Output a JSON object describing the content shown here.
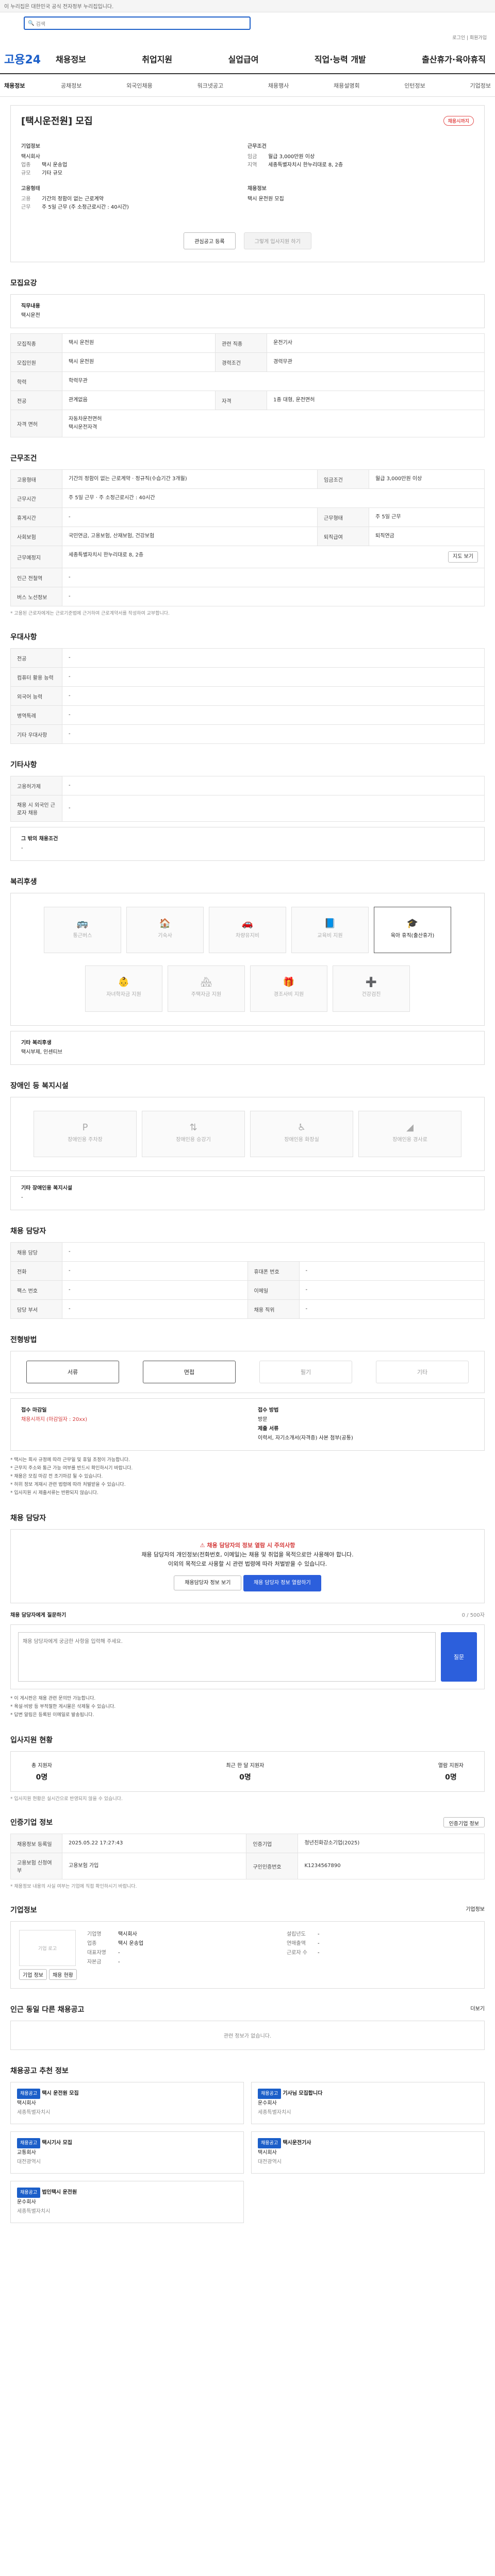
{
  "top": {
    "notice": "이 누리집은 대한민국 공식 전자정부 누리집입니다."
  },
  "header": {
    "search_placeholder": "검색",
    "login": "로그인",
    "join": "회원가입",
    "logo": "고용24",
    "menu": [
      "채용정보",
      "취업지원",
      "실업급여",
      "직업·능력 개발",
      "출산휴가·육아휴직"
    ]
  },
  "lnb": {
    "first": "채용정보",
    "items": [
      "공채정보",
      "외국인채용",
      "워크넷공고",
      "채용행사",
      "채용설명회",
      "인턴정보",
      "기업정보"
    ]
  },
  "job": {
    "title": "[택시운전원] 모집",
    "badge": "채용시까지",
    "company_label": "기업정보",
    "company": "택시회사",
    "company_rows": [
      {
        "k": "업종",
        "v": "택시 운송업"
      },
      {
        "k": "규모",
        "v": "기타 규모"
      }
    ],
    "cond_label": "근무조건",
    "cond_rows": [
      {
        "k": "임금",
        "v": "월급 3,000만원 이상"
      },
      {
        "k": "지역",
        "v": "세종특별자치시 한누리대로 8, 2층"
      }
    ],
    "type_label": "고용형태",
    "type_rows": [
      {
        "k": "고용",
        "v": "기간의 정함이 없는 근로계약"
      },
      {
        "k": "근무",
        "v": "주 5일 근무 (주 소정근로시간 : 40시간)"
      }
    ],
    "process_label": "채용정보",
    "process_v": "택시 운전원 모집",
    "btn_save": "관심공고 등록",
    "btn_apply": "그렇게 입사지원 하기"
  },
  "sec": {
    "req": "모집요강",
    "cond": "근무조건",
    "welfare": "우대사항",
    "other": "기타사항",
    "benefit": "복리후생",
    "disability": "장애인 등 복지시설",
    "process": "전형방법",
    "contact": "채용 담당자",
    "interview": "입사지원 현황",
    "info": "인증기업 정보",
    "corp": "기업정보",
    "related": "인근 동일 다른 채용공고",
    "rec": "채용공고 추천 정보"
  },
  "req": {
    "duty_label": "직무내용",
    "duty": "택시운전",
    "rows": [
      {
        "k": "모집직종",
        "v": "택시 운전원",
        "k2": "관련 직종",
        "v2": "운전기사"
      },
      {
        "k": "모집인원",
        "v": "택시 운전원",
        "k2": "경력조건",
        "v2": "경력무관"
      },
      {
        "k": "학력",
        "v": "학력무관",
        "k2": "",
        "v2": ""
      },
      {
        "k": "전공",
        "v": "관계없음",
        "k2": "자격",
        "v2": "1종 대형, 운전면허"
      }
    ],
    "lic_label": "자격 면허",
    "lic": [
      "자동차운전면허",
      "택시운전자격"
    ]
  },
  "cond": {
    "rows": [
      {
        "k": "고용형태",
        "v": "기간의 정함이 없는 근로계약 · 정규직(수습기간 3개월)",
        "k2": "임금조건",
        "v2": "월급 3,000만원 이상"
      },
      {
        "k": "근무시간",
        "v": "주 5일 근무 · 주 소정근로시간 : 40시간",
        "k2": "",
        "v2": ""
      },
      {
        "k": "휴게시간",
        "v": "-",
        "k2": "근무형태",
        "v2": "주 5일 근무"
      },
      {
        "k": "사회보험",
        "v": "국민연금, 고용보험, 산재보험, 건강보험",
        "k2": "퇴직급여",
        "v2": "퇴직연금"
      },
      {
        "k": "근무예정지",
        "v": "세종특별자치시 한누리대로 8, 2층",
        "k2": "",
        "v2": ""
      },
      {
        "k": "인근 전철역",
        "v": "-",
        "k2": "",
        "v2": ""
      },
      {
        "k": "버스 노선정보",
        "v": "-",
        "k2": "",
        "v2": ""
      }
    ],
    "map_btn": "지도 보기",
    "note": "* 고용된 근로자에게는 근로기준법에 근거하여 근로계약서를 작성하여 교부합니다."
  },
  "welfare": {
    "rows": [
      {
        "k": "전공",
        "v": "-"
      },
      {
        "k": "컴퓨터 활용 능력",
        "v": "-"
      },
      {
        "k": "외국어 능력",
        "v": "-"
      },
      {
        "k": "병역특례",
        "v": "-"
      },
      {
        "k": "기타 우대사항",
        "v": "-"
      }
    ]
  },
  "other": {
    "rows": [
      {
        "k": "고용허가제",
        "v": "-"
      },
      {
        "k": "채용 시 외국인 근로자 채용",
        "v": "-"
      }
    ],
    "note_label": "그 밖의 채용조건",
    "note": "-"
  },
  "benefit": {
    "items": [
      "통근버스",
      "기숙사",
      "차량유지비",
      "교육비 지원",
      "육아 휴직(출산휴가)",
      "자녀학자금 지원",
      "주택자금 지원",
      "경조사비 지원",
      "건강검진"
    ],
    "active": 4,
    "extra_label": "기타 복리후생",
    "extra": "택시부제, 인센티브"
  },
  "disability": {
    "items": [
      "장애인용 주차장",
      "장애인용 승강기",
      "장애인용 화장실",
      "장애인용 경사로"
    ],
    "extra_label": "기타 장애인용 복지시설",
    "extra": "-"
  },
  "workrows": [
    {
      "k": "채용 담당",
      "v": "-",
      "k2": "",
      "v2": ""
    },
    {
      "k": "전화",
      "v": "-",
      "k2": "휴대폰 번호",
      "v2": "-"
    },
    {
      "k": "팩스 번호",
      "v": "-",
      "k2": "이메일",
      "v2": "-"
    },
    {
      "k": "담당 부서",
      "v": "-",
      "k2": "채용 직위",
      "v2": "-"
    }
  ],
  "process": {
    "steps": [
      "서류",
      "면접",
      "필기",
      "기타"
    ],
    "active": [
      0,
      1
    ],
    "left_label": "접수 마감일",
    "left_v": "채용시까지 (마감일자 : 20xx)",
    "right_label": "접수 방법",
    "right_v": "방문",
    "doc_label": "제출 서류",
    "doc_v": "이력서, 자기소개서(자격증) 사본 첨부(공통)"
  },
  "notes": [
    "* 택시는 회사 규정에 따라 근무일 및 휴일 조정이 가능합니다.",
    "* 근무지 주소와 통근 가능 여부를 반드시 확인하시기 바랍니다.",
    "* 채용은 모집 마감 전 조기마감 될 수 있습니다.",
    "* 허위 정보 게재시 관련 법령에 따라 처벌받을 수 있습니다.",
    "* 입사지원 시 제출서류는 반환되지 않습니다."
  ],
  "contact": {
    "warn": "채용 담당자의 정보 열람 시 주의사항",
    "t1": "채용 담당자의 개인정보(전화번호, 이메일)는 채용 및 취업을 목적으로만 사용해야 합니다.",
    "t2": "이외의 목적으로 사용할 시 관련 법령에 따라 처벌받을 수 있습니다.",
    "btn_a": "채용담당자 정보 보기",
    "btn_b": "채용 담당자 정보 열람하기"
  },
  "qa": {
    "label": "채용 담당자에게 질문하기",
    "hint": "0 / 500자",
    "placeholder": "채용 담당자에게 궁금한 사항을 입력해 주세요.",
    "submit": "질문",
    "notes": [
      "* 이 게시판은 채용 관련 문의만 가능합니다.",
      "* 욕설·비방 등 부적절한 게시물은 삭제될 수 있습니다.",
      "* 답변 알림은 등록된 이메일로 발송됩니다."
    ]
  },
  "interview": {
    "items": [
      {
        "k": "총 지원자",
        "v": "0명"
      },
      {
        "k": "최근 한 달 지원자",
        "v": "0명"
      },
      {
        "k": "열람 지원자",
        "v": "0명"
      }
    ],
    "note": "* 입사지원 현황은 실시간으로 반영되지 않을 수 있습니다."
  },
  "info": {
    "btn": "인증기업 정보",
    "rows": [
      {
        "k": "채용정보 등록일",
        "v": "2025.05.22 17:27:43",
        "k2": "인증기업",
        "v2": "청년친화강소기업(2025)"
      },
      {
        "k": "고용보험 신청여부",
        "v": "고용보험 가입",
        "k2": "구인인증번호",
        "v2": "K1234567890"
      }
    ],
    "note": "* 채용정보 내용의 사실 여부는 기업에 직접 확인하시기 바랍니다."
  },
  "corp": {
    "btn": "기업정보",
    "logo": "기업 로고",
    "name": "택시회사",
    "rows": [
      {
        "k": "기업명",
        "v": "택시회사"
      },
      {
        "k": "업종",
        "v": "택시 운송업"
      },
      {
        "k": "대표자명",
        "v": "-"
      },
      {
        "k": "자본금",
        "v": "-"
      }
    ],
    "rows2": [
      {
        "k": "설립년도",
        "v": "-"
      },
      {
        "k": "연매출액",
        "v": "-"
      },
      {
        "k": "근로자 수",
        "v": "-"
      }
    ],
    "btns": [
      "기업 정보",
      "채용 현황"
    ]
  },
  "related": {
    "more": "더보기",
    "empty": "관련 정보가 없습니다."
  },
  "rec": {
    "cards": [
      {
        "tag": "채용공고",
        "title": "택시 운전원 모집",
        "sub": "택시회사",
        "loc": "세종특별자치시"
      },
      {
        "tag": "채용공고",
        "title": "기사님 모집합니다",
        "sub": "운수회사",
        "loc": "세종특별자치시"
      },
      {
        "tag": "채용공고",
        "title": "택시기사 모집",
        "sub": "교통회사",
        "loc": "대전광역시"
      },
      {
        "tag": "채용공고",
        "title": "택시운전기사",
        "sub": "택시회사",
        "loc": "대전광역시"
      },
      {
        "tag": "채용공고",
        "title": "법인택시 운전원",
        "sub": "운수회사",
        "loc": "세종특별자치시"
      }
    ]
  }
}
